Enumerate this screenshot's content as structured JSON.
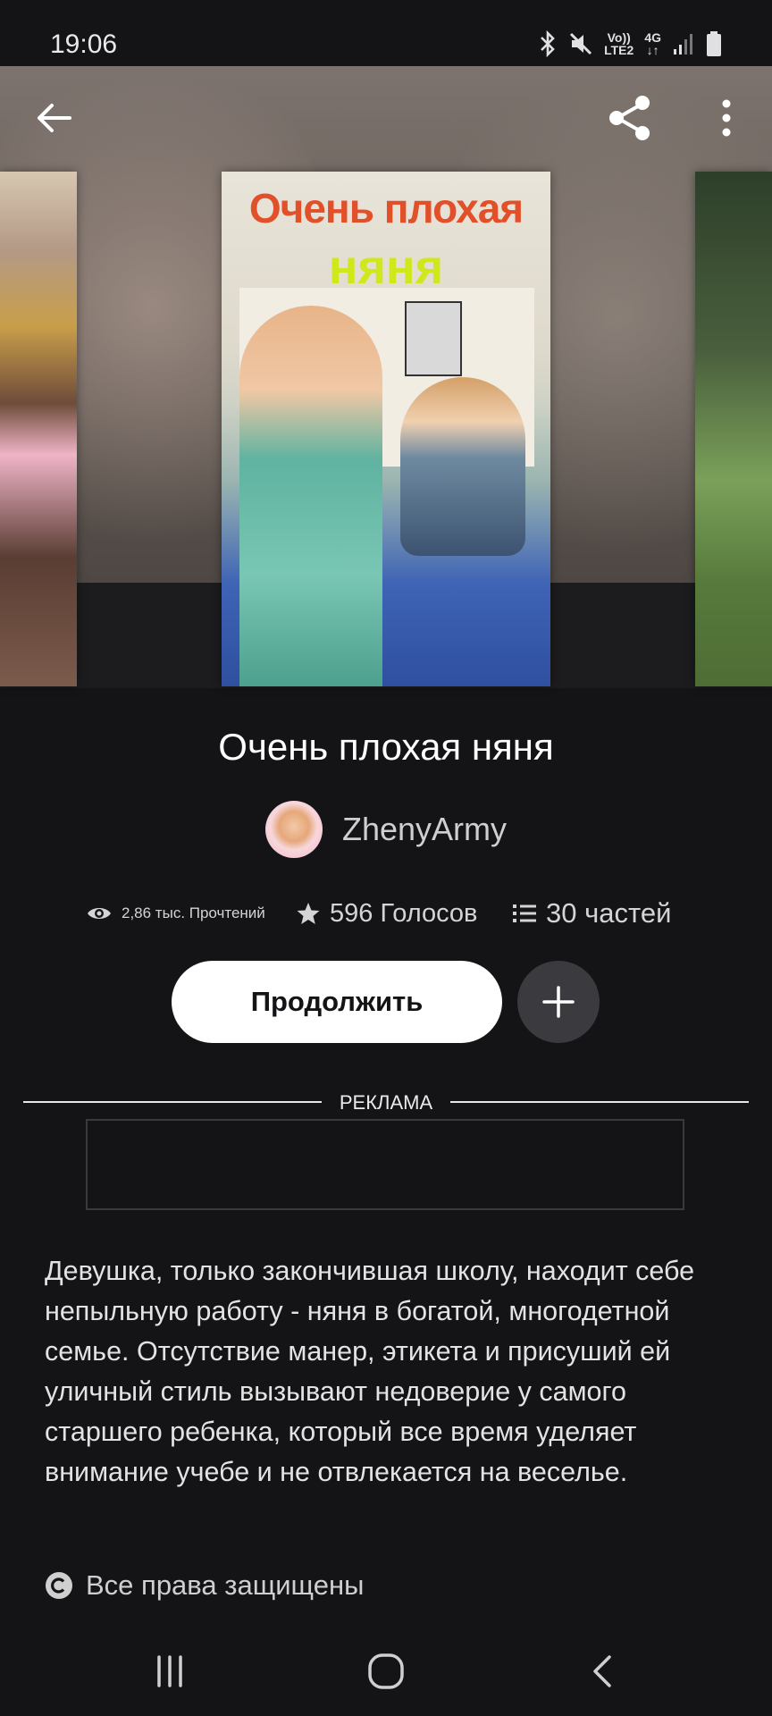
{
  "status_bar": {
    "time": "19:06",
    "volte_label": "Vo))",
    "lte_label": "LTE2",
    "network_label": "4G",
    "icons": [
      "bluetooth-icon",
      "mute-icon",
      "signal-icon",
      "battery-icon"
    ]
  },
  "header": {
    "icons": [
      "back-arrow-icon",
      "share-icon",
      "more-vertical-icon"
    ]
  },
  "cover": {
    "title_line1": "Очень плохая",
    "title_line2": "няня"
  },
  "book": {
    "title": "Очень плохая няня",
    "author": "ZhenyArmy"
  },
  "stats": {
    "reads": "2,86 тыс. Прочтений",
    "votes": "596 Голосов",
    "parts": "30 частей"
  },
  "actions": {
    "continue_label": "Продолжить",
    "add_icon": "plus-icon"
  },
  "ad": {
    "label": "РЕКЛАМА"
  },
  "description": "Девушка, только закончившая школу, находит себе непыльную работу - няня в богатой, многодетной семье. Отсутствие манер, этикета и присуший ей уличный стиль вызывают недоверие у самого старшего ребенка, который все время уделяет внимание учебе и не отвлекается на веселье.",
  "copyright": {
    "text": "Все права защищены",
    "icon": "copyright-icon"
  },
  "navbar": {
    "icons": [
      "recent-apps-icon",
      "home-icon",
      "back-icon"
    ]
  },
  "colors": {
    "background": "#141316",
    "button_bg": "#ffffff",
    "add_button_bg": "#3b3a3e"
  }
}
